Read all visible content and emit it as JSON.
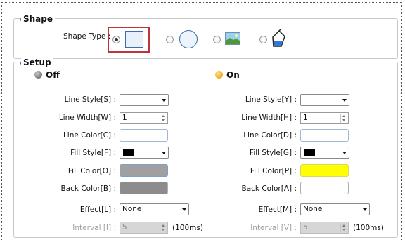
{
  "shape_group": {
    "title": "Shape",
    "shape_type_label": "Shape Type :",
    "options": [
      "rectangle",
      "ellipse",
      "picture",
      "bitmap-shape"
    ],
    "selected": "rectangle"
  },
  "setup_group": {
    "title": "Setup",
    "off": {
      "title": "Off",
      "indicator_color": "#7a7a7a",
      "line_style_label": "Line Style[S] :",
      "line_width_label": "Line Width[W] :",
      "line_width_value": "1",
      "line_color_label": "Line Color[C] :",
      "line_color": "#ffffff",
      "fill_style_label": "Fill Style[F] :",
      "fill_color_label": "Fill Color[O] :",
      "fill_color": "#a0a0a0",
      "back_color_label": "Back Color[B] :",
      "back_color": "#8c8c8c",
      "effect_label": "Effect[L] :",
      "effect_value": "None",
      "interval_label": "Interval [I] :",
      "interval_value": "5",
      "interval_unit": "(100ms)"
    },
    "on": {
      "title": "On",
      "indicator_color": "#f0a000",
      "line_style_label": "Line Style[Y] :",
      "line_width_label": "Line Width[H] :",
      "line_width_value": "1",
      "line_color_label": "Line Color[D] :",
      "line_color": "#ffffff",
      "fill_style_label": "Fill Style[G] :",
      "fill_color_label": "Fill Color[P] :",
      "fill_color": "#ffff00",
      "back_color_label": "Back Color[A] :",
      "back_color": "#ffffff",
      "effect_label": "Effect[M] :",
      "effect_value": "None",
      "interval_label": "Interval [V] :",
      "interval_value": "5",
      "interval_unit": "(100ms)"
    }
  }
}
